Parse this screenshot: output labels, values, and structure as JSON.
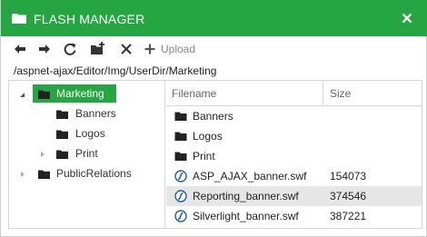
{
  "window": {
    "title": "FLASH MANAGER",
    "accent_color": "#26a642",
    "title_icon": "folder-icon",
    "close_icon": "close-icon"
  },
  "toolbar": {
    "buttons": [
      {
        "name": "back",
        "icon": "arrow-left-icon"
      },
      {
        "name": "forward",
        "icon": "arrow-right-icon"
      },
      {
        "name": "refresh",
        "icon": "refresh-icon"
      },
      {
        "name": "new-folder",
        "icon": "new-folder-icon"
      },
      {
        "name": "delete",
        "icon": "delete-x-icon"
      }
    ],
    "upload_label": "Upload",
    "upload_icon": "plus-icon"
  },
  "path": "/aspnet-ajax/Editor/Img/UserDir/Marketing",
  "tree": {
    "nodes": [
      {
        "label": "Marketing",
        "selected": true,
        "expanded": true
      },
      {
        "label": "Banners",
        "selected": false
      },
      {
        "label": "Logos",
        "selected": false
      },
      {
        "label": "Print",
        "selected": false,
        "expandable": true
      },
      {
        "label": "PublicRelations",
        "selected": false,
        "expandable": true
      }
    ]
  },
  "grid": {
    "columns": {
      "name": "Filename",
      "size": "Size"
    },
    "rows": [
      {
        "name": "Banners",
        "size": "",
        "type": "folder"
      },
      {
        "name": "Logos",
        "size": "",
        "type": "folder"
      },
      {
        "name": "Print",
        "size": "",
        "type": "folder"
      },
      {
        "name": "ASP_AJAX_banner.swf",
        "size": "154073",
        "type": "swf"
      },
      {
        "name": "Reporting_banner.swf",
        "size": "374546",
        "type": "swf",
        "selected": true
      },
      {
        "name": "Silverlight_banner.swf",
        "size": "387221",
        "type": "swf"
      }
    ]
  }
}
